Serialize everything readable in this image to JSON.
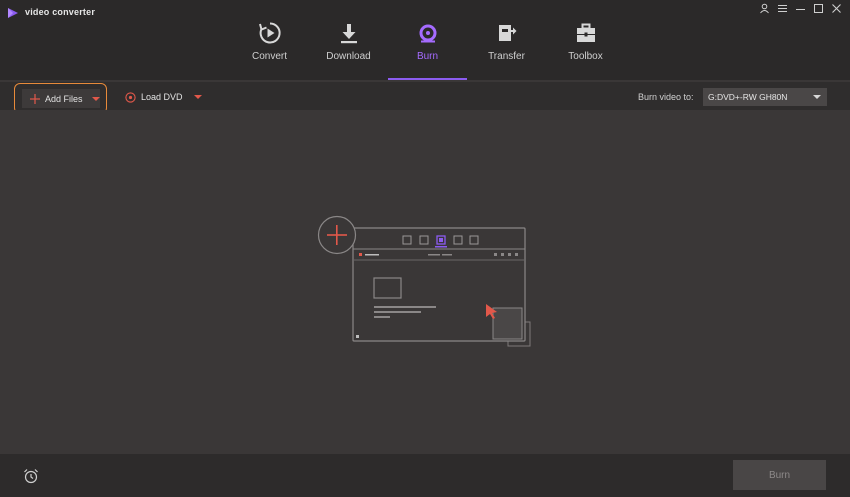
{
  "app": {
    "title": "video converter"
  },
  "nav": {
    "items": [
      {
        "label": "Convert",
        "icon": "convert-icon"
      },
      {
        "label": "Download",
        "icon": "download-icon"
      },
      {
        "label": "Burn",
        "icon": "burn-icon",
        "active": true
      },
      {
        "label": "Transfer",
        "icon": "transfer-icon"
      },
      {
        "label": "Toolbox",
        "icon": "toolbox-icon"
      }
    ]
  },
  "toolbar": {
    "add_files_label": "Add Files",
    "load_dvd_label": "Load DVD",
    "burn_to_label": "Burn video to:",
    "burn_target_value": "G:DVD+-RW GH80N"
  },
  "footer": {
    "burn_label": "Burn"
  },
  "colors": {
    "accent": "#8c5cf0",
    "highlight_border": "#e78a3a",
    "icon_red": "#e2584a",
    "background": "#3a3737"
  }
}
